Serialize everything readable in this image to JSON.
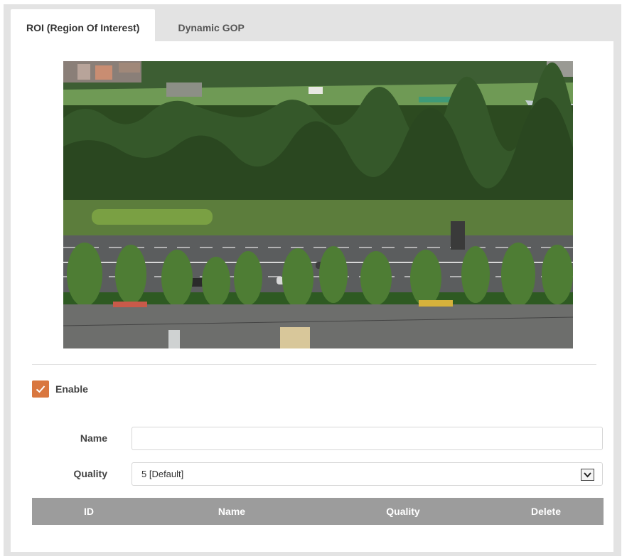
{
  "tabs": [
    {
      "label": "ROI (Region Of Interest)",
      "active": true
    },
    {
      "label": "Dynamic GOP",
      "active": false
    }
  ],
  "preview": {
    "icon": "camera-live-view-icon"
  },
  "enable": {
    "label": "Enable",
    "checked": true
  },
  "name_field": {
    "label": "Name",
    "value": "",
    "placeholder": ""
  },
  "quality_field": {
    "label": "Quality",
    "selected": "5 [Default]"
  },
  "table": {
    "columns": [
      "ID",
      "Name",
      "Quality",
      "Delete"
    ],
    "rows": []
  },
  "colors": {
    "accent": "#d9773f",
    "table_header": "#9c9c9c",
    "frame": "#e3e3e3"
  }
}
